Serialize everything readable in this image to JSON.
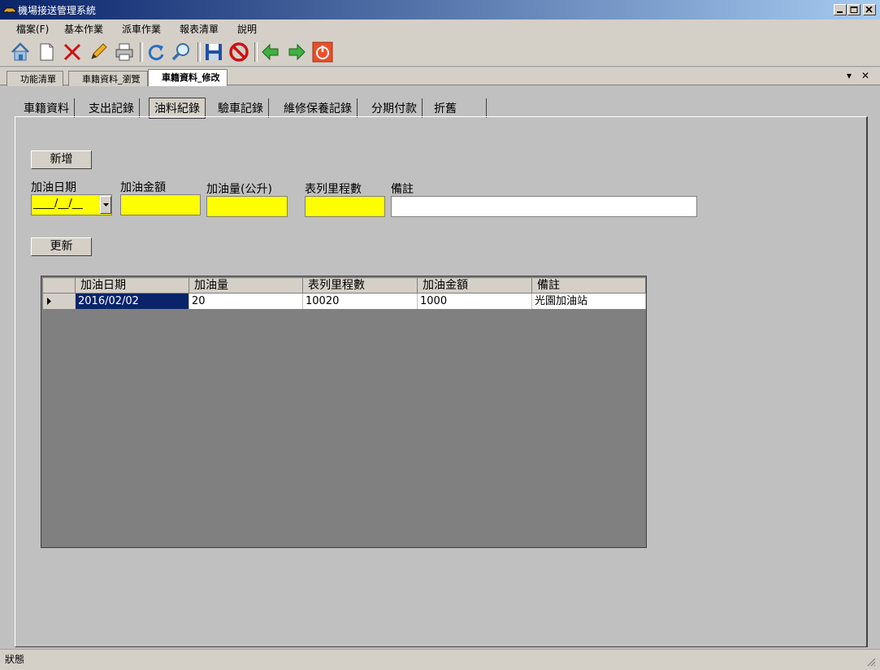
{
  "window": {
    "title": "機場接送管理系統"
  },
  "menu": [
    "檔案(F)",
    "基本作業",
    "派車作業",
    "報表清單",
    "說明"
  ],
  "toolbar": {
    "buttons": [
      "home-icon",
      "new-document-icon",
      "delete-icon",
      "edit-pencil-icon",
      "print-icon",
      "refresh-icon",
      "search-icon",
      "save-icon",
      "cancel-icon",
      "back-arrow-icon",
      "forward-arrow-icon",
      "power-icon"
    ]
  },
  "doc_tabs": [
    "功能清單",
    "車籍資料_瀏覽",
    "車籍資料_修改"
  ],
  "doc_tab_controls": {
    "dropdown": "▾",
    "close": "✕"
  },
  "sub_tabs": [
    "車籍資料",
    "支出記錄",
    "油料紀錄",
    "驗車記錄",
    "維修保養記錄",
    "分期付款",
    "折舊"
  ],
  "form": {
    "add_button": "新增",
    "update_button": "更新",
    "labels": {
      "date": "加油日期",
      "amount": "加油金額",
      "volume": "加油量(公升)",
      "odometer": "表列里程數",
      "note": "備註"
    },
    "date_value": "____/__/__"
  },
  "grid": {
    "columns": [
      "加油日期",
      "加油量",
      "表列里程數",
      "加油金額",
      "備註"
    ],
    "rows": [
      [
        "2016/02/02",
        "20",
        "10020",
        "1000",
        "光園加油站"
      ]
    ]
  },
  "status": {
    "text": "狀態"
  }
}
